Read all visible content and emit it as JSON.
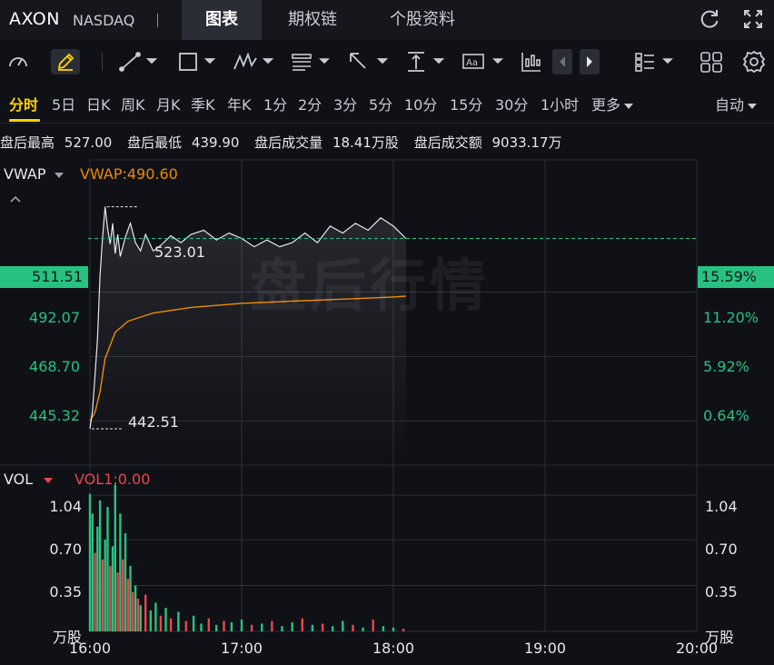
{
  "header": {
    "ticker": "AXON",
    "exchange": "NASDAQ",
    "tabs": [
      {
        "label": "图表",
        "active": true
      },
      {
        "label": "期权链",
        "active": false
      },
      {
        "label": "个股资料",
        "active": false
      }
    ],
    "icons": [
      "refresh-icon",
      "fullscreen-icon"
    ]
  },
  "toolbar": {
    "icons": [
      "gauge-icon",
      "pencil-icon",
      "line-tool-icon",
      "rectangle-tool-icon",
      "wave-tool-icon",
      "fibonacci-tool-icon",
      "arrow-tool-icon",
      "measure-tool-icon",
      "text-tool-icon",
      "candle-icon",
      "chevron-left-icon",
      "chevron-right-icon",
      "layout-list-icon",
      "grid-icon",
      "settings-icon"
    ]
  },
  "periods": {
    "items": [
      "分时",
      "5日",
      "日K",
      "周K",
      "月K",
      "季K",
      "年K",
      "1分",
      "2分",
      "3分",
      "5分",
      "10分",
      "15分",
      "30分",
      "1小时"
    ],
    "active": "分时",
    "more": "更多",
    "auto": "自动"
  },
  "stats": {
    "high_label": "盘后最高",
    "high_value": "527.00",
    "low_label": "盘后最低",
    "low_value": "439.90",
    "volume_label": "盘后成交量",
    "volume_value": "18.41万股",
    "amount_label": "盘后成交额",
    "amount_value": "9033.17万"
  },
  "price_panel": {
    "indicator": "VWAP",
    "indicator_value": "VWAP:490.60",
    "watermark": "盘后行情",
    "left_axis": [
      "492.07",
      "468.70",
      "445.32"
    ],
    "right_axis": [
      "11.20%",
      "5.92%",
      "0.64%"
    ],
    "current_price_tag": "511.51",
    "current_pct_tag": "15.59%",
    "max_label": "523.01",
    "min_label": "442.51",
    "colors": {
      "up": "#27c281",
      "down": "#e8484b",
      "vwap": "#f08a00",
      "price": "#e6e8ee"
    }
  },
  "volume_panel": {
    "indicator": "VOL",
    "indicator_value": "VOL1:0.00",
    "left_axis": [
      "1.04",
      "0.70",
      "0.35"
    ],
    "right_axis": [
      "1.04",
      "0.70",
      "0.35"
    ],
    "unit": "万股"
  },
  "time_axis": [
    "16:00",
    "17:00",
    "18:00",
    "19:00",
    "20:00"
  ],
  "chart_data": {
    "type": "line",
    "x_unit": "time",
    "x_range": [
      "16:00",
      "20:00"
    ],
    "price_range": [
      430.0,
      540.0
    ],
    "series": [
      {
        "name": "VWAP",
        "color": "#f08a00",
        "x": [
          "16:00",
          "16:02",
          "16:04",
          "16:06",
          "16:10",
          "16:15",
          "16:25",
          "16:40",
          "17:00",
          "17:20",
          "17:40",
          "18:00",
          "18:05"
        ],
        "values": [
          445.3,
          448.5,
          456.0,
          468.0,
          477.5,
          481.5,
          484.5,
          486.5,
          488.0,
          488.8,
          489.5,
          490.3,
          490.6
        ]
      },
      {
        "x": [
          "16:00",
          "16:01",
          "16:02",
          "16:03",
          "16:04",
          "16:05",
          "16:06",
          "16:07",
          "16:08",
          "16:09",
          "16:10",
          "16:11",
          "16:12",
          "16:14",
          "16:16",
          "16:18",
          "16:20",
          "16:22",
          "16:25",
          "16:28",
          "16:32",
          "16:36",
          "16:40",
          "16:45",
          "16:50",
          "16:55",
          "17:00",
          "17:05",
          "17:10",
          "17:15",
          "17:20",
          "17:25",
          "17:30",
          "17:35",
          "17:40",
          "17:45",
          "17:50",
          "17:55",
          "18:00",
          "18:05"
        ],
        "values": [
          442.5,
          449.0,
          462.0,
          475.0,
          498.0,
          512.0,
          523.0,
          515.0,
          509.5,
          517.0,
          506.0,
          513.0,
          505.0,
          512.0,
          517.0,
          510.0,
          507.0,
          513.0,
          507.0,
          509.0,
          512.5,
          510.0,
          513.0,
          514.5,
          511.0,
          513.5,
          511.5,
          508.5,
          511.0,
          508.5,
          510.0,
          513.5,
          510.0,
          516.0,
          513.5,
          517.0,
          514.5,
          519.0,
          516.0,
          511.5
        ]
      }
    ],
    "volume_unit": "万股",
    "volume_range": [
      0,
      1.2
    ],
    "volume": {
      "x": [
        "16:00",
        "16:01",
        "16:02",
        "16:03",
        "16:04",
        "16:05",
        "16:06",
        "16:07",
        "16:08",
        "16:09",
        "16:10",
        "16:11",
        "16:12",
        "16:13",
        "16:14",
        "16:15",
        "16:16",
        "16:17",
        "16:18",
        "16:19",
        "16:20",
        "16:22",
        "16:24",
        "16:26",
        "16:28",
        "16:30",
        "16:32",
        "16:35",
        "16:38",
        "16:41",
        "16:44",
        "16:47",
        "16:50",
        "16:53",
        "16:56",
        "17:00",
        "17:04",
        "17:08",
        "17:12",
        "17:16",
        "17:20",
        "17:24",
        "17:28",
        "17:32",
        "17:36",
        "17:40",
        "17:44",
        "17:48",
        "17:52",
        "17:56",
        "18:00",
        "18:04"
      ],
      "values": [
        1.05,
        0.9,
        0.6,
        0.8,
        1.0,
        0.55,
        0.7,
        0.95,
        0.5,
        0.65,
        1.12,
        0.45,
        0.9,
        0.55,
        0.75,
        0.4,
        0.5,
        0.3,
        0.35,
        0.25,
        0.2,
        0.28,
        0.16,
        0.22,
        0.12,
        0.18,
        0.1,
        0.15,
        0.08,
        0.12,
        0.06,
        0.1,
        0.05,
        0.08,
        0.07,
        0.09,
        0.05,
        0.06,
        0.08,
        0.04,
        0.07,
        0.1,
        0.05,
        0.06,
        0.04,
        0.08,
        0.05,
        0.03,
        0.09,
        0.04,
        0.03,
        0.02
      ],
      "direction": [
        "up",
        "up",
        "down",
        "up",
        "up",
        "down",
        "up",
        "up",
        "down",
        "up",
        "up",
        "down",
        "up",
        "down",
        "up",
        "down",
        "up",
        "down",
        "up",
        "down",
        "up",
        "down",
        "up",
        "up",
        "down",
        "up",
        "down",
        "up",
        "down",
        "up",
        "up",
        "down",
        "up",
        "down",
        "up",
        "up",
        "down",
        "up",
        "down",
        "up",
        "up",
        "down",
        "up",
        "down",
        "up",
        "up",
        "down",
        "up",
        "down",
        "up",
        "up",
        "down"
      ]
    },
    "annotations": [
      {
        "text": "523.01",
        "x": "16:06",
        "value": 523.01
      },
      {
        "text": "442.51",
        "x": "16:00",
        "value": 442.51
      }
    ]
  }
}
